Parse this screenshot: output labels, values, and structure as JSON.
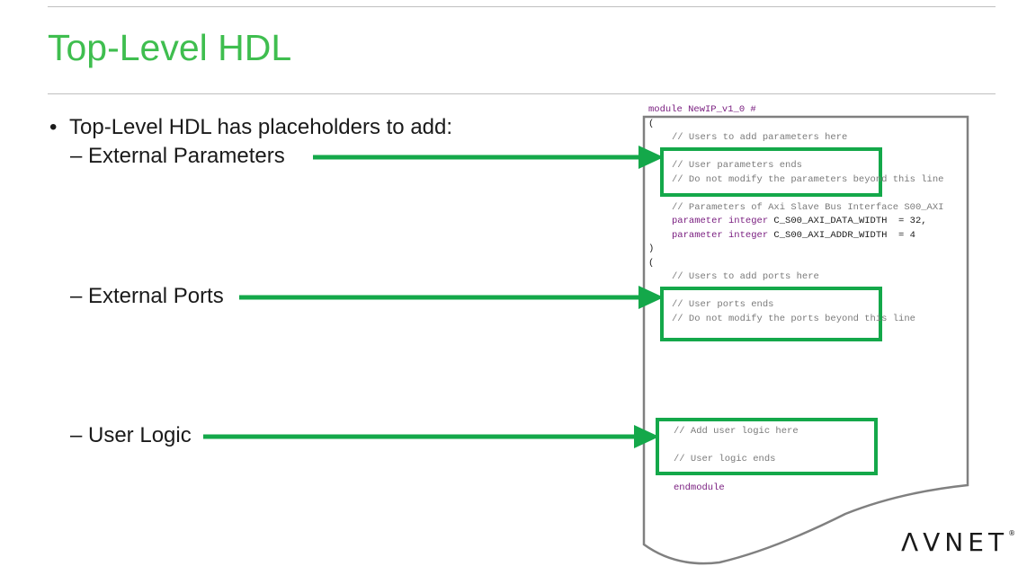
{
  "slide": {
    "title": "Top-Level HDL",
    "bullet": "Top-Level HDL has placeholders to add:",
    "sub_items": [
      {
        "dash": "–",
        "label": "External Parameters"
      },
      {
        "dash": "–",
        "label": "External Ports"
      },
      {
        "dash": "–",
        "label": "User Logic"
      }
    ]
  },
  "code": {
    "module_line": "module NewIP_v1_0 #",
    "open_paren_1": "(",
    "users_params": "// Users to add parameters here",
    "user_params_ends": "// User parameters ends",
    "do_not_modify_params": "// Do not modify the parameters beyond this line",
    "axi_params_comment": "// Parameters of Axi Slave Bus Interface S00_AXI",
    "param1_kw": "parameter integer",
    "param1_rest": " C_S00_AXI_DATA_WIDTH  = 32,",
    "param2_kw": "parameter integer",
    "param2_rest": " C_S00_AXI_ADDR_WIDTH  = 4",
    "close_paren_1": ")",
    "open_paren_2": "(",
    "users_ports": "// Users to add ports here",
    "user_ports_ends": "// User ports ends",
    "do_not_modify_ports": "// Do not modify the ports beyond this line",
    "add_user_logic": "// Add user logic here",
    "user_logic_ends": "// User logic ends",
    "endmodule": "endmodule"
  },
  "logo": {
    "text": "ΛVNET",
    "mark": "®"
  },
  "colors": {
    "title_green": "#3fbe4f",
    "arrow_green": "#14a84a",
    "keyword_purple": "#7a1f80",
    "comment_gray": "#7a7a7a"
  }
}
